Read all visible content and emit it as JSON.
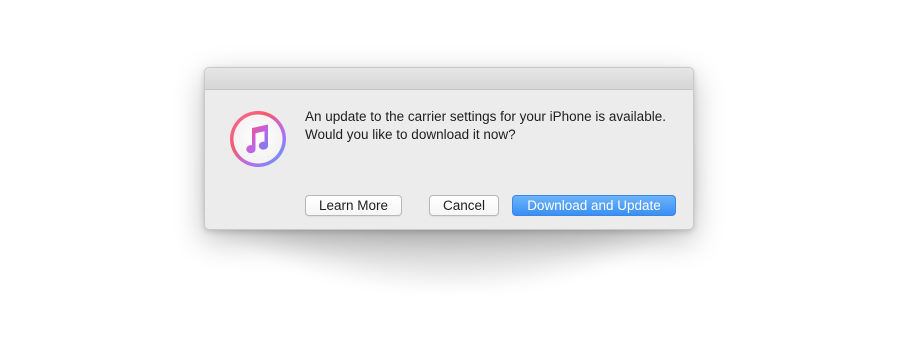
{
  "dialog": {
    "message_line1": "An update to the carrier settings for your iPhone is available.",
    "message_line2": "Would you like to download it now?",
    "icon": "itunes-music-note-icon",
    "buttons": {
      "learn_more": "Learn More",
      "cancel": "Cancel",
      "download_and_update": "Download and Update"
    }
  },
  "colors": {
    "primary_button": "#3a8ff5",
    "dialog_background": "#ececec"
  }
}
